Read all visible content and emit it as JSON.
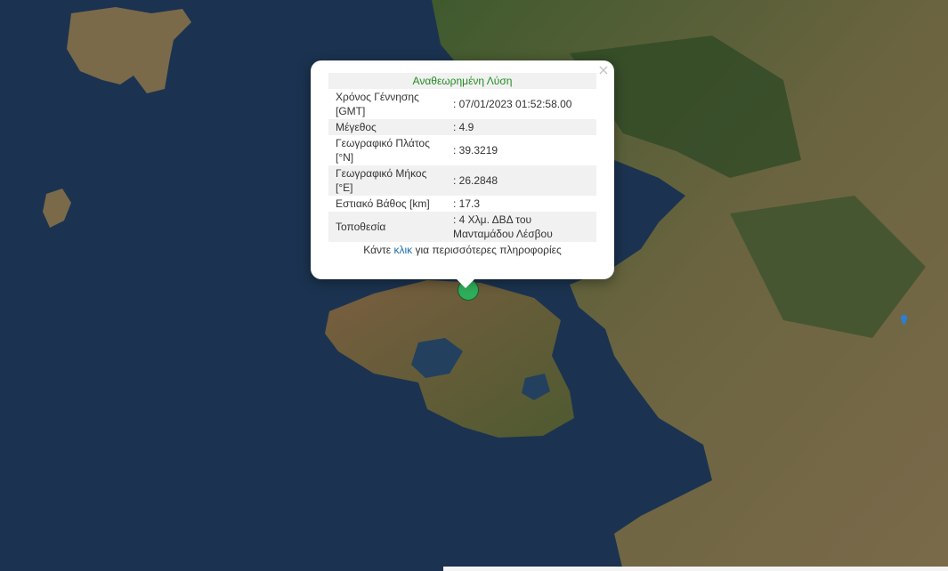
{
  "popup": {
    "title": "Αναθεωρημένη Λύση",
    "close": "×",
    "rows": [
      {
        "label": "Χρόνος Γέννησης [GMT]",
        "value": ": 07/01/2023 01:52:58.00"
      },
      {
        "label": "Μέγεθος",
        "value": ": 4.9"
      },
      {
        "label": "Γεωγραφικό Πλάτος [°N]",
        "value": ": 39.3219"
      },
      {
        "label": "Γεωγραφικό Μήκος [°E]",
        "value": ": 26.2848"
      },
      {
        "label": "Εστιακό Βάθος [km]",
        "value": ": 17.3"
      },
      {
        "label": "Τοποθεσία",
        "value": ": 4 Χλμ. ΔΒΔ του Μανταμάδου Λέσβου"
      }
    ],
    "more_prefix": "Κάντε ",
    "more_link": "κλικ",
    "more_suffix": " για περισσότερες πληροφορίες"
  },
  "colors": {
    "sea": "#1b3350",
    "land": "#5a5a36",
    "marker": "#2fae5a",
    "title": "#228b22"
  },
  "icons": {
    "epicenter": "circle-marker-icon",
    "pin": "blue-pin-icon"
  }
}
